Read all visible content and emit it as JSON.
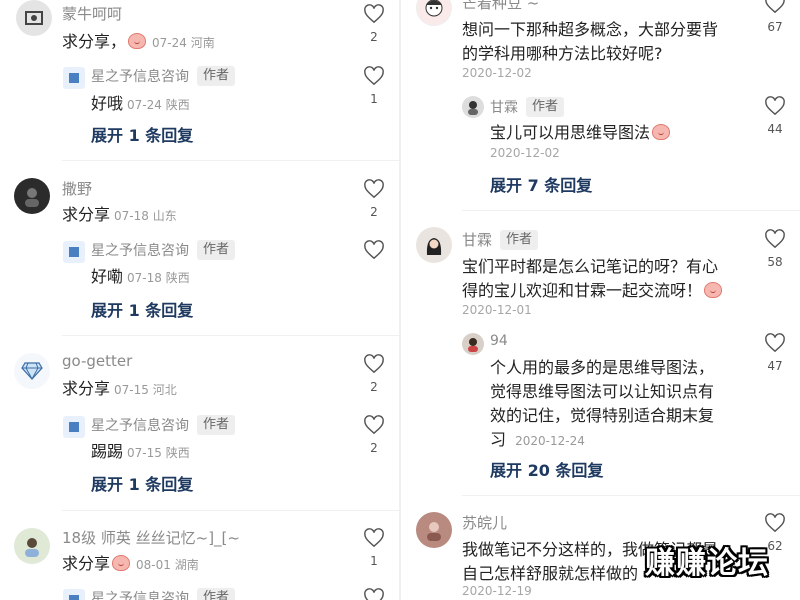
{
  "left": {
    "threads": [
      {
        "user": "蒙牛呵呵",
        "text": "求分享，",
        "emoji": true,
        "meta": "07-24 河南",
        "likes": "2",
        "reply": {
          "user": "星之予信息咨询",
          "tag": "作者",
          "text": "好哦",
          "meta": "07-24 陕西",
          "likes": "1"
        },
        "expand": "展开 1 条回复"
      },
      {
        "user": "撒野",
        "text": "求分享",
        "emoji": false,
        "meta": "07-18 山东",
        "likes": "2",
        "reply": {
          "user": "星之予信息咨询",
          "tag": "作者",
          "text": "好嘞",
          "meta": "07-18 陕西",
          "likes": ""
        },
        "expand": "展开 1 条回复"
      },
      {
        "user": "go-getter",
        "text": "求分享",
        "emoji": false,
        "meta": "07-15 河北",
        "likes": "2",
        "reply": {
          "user": "星之予信息咨询",
          "tag": "作者",
          "text": "踢踢",
          "meta": "07-15 陕西",
          "likes": "2"
        },
        "expand": "展开 1 条回复"
      },
      {
        "user": "18级 师英 丝丝记忆~]_[~",
        "text": "求分享",
        "emoji": true,
        "meta": "08-01 湖南",
        "likes": "1",
        "reply": {
          "user": "星之予信息咨询",
          "tag": "作者"
        }
      }
    ]
  },
  "right": {
    "t1": {
      "user": "芒着种豆 ~",
      "likes": "67",
      "text_lines": [
        "想问一下那种超多概念，大部分要背",
        "的学科用哪种方法比较好呢?"
      ],
      "date": "2020-12-02",
      "reply": {
        "user": "甘霖",
        "tag": "作者",
        "text": "宝儿可以用思维导图法",
        "date": "2020-12-02",
        "likes": "44"
      },
      "expand": "展开 7 条回复"
    },
    "t2": {
      "user": "甘霖",
      "tag": "作者",
      "likes": "58",
      "text_lines": [
        "宝们平时都是怎么记笔记的呀？有心",
        "得的宝儿欢迎和甘霖一起交流呀！"
      ],
      "date": "2020-12-01",
      "reply": {
        "user": "94",
        "likes": "47",
        "text_lines": [
          "个人用的最多的是思维导图法，",
          "觉得思维导图法可以让知识点有",
          "效的记住，觉得特别适合期末复",
          "习"
        ],
        "date": "2020-12-24"
      },
      "expand": "展开 20 条回复"
    },
    "t3": {
      "user": "苏皖儿",
      "likes": "62",
      "text_lines": [
        "我做笔记不分这样的，我做笔记都是",
        "自己怎样舒服就怎样做的"
      ],
      "date": "2020-12-19"
    }
  },
  "watermark": "赚赚论坛",
  "colors": {
    "expand": "#1f3a60",
    "name": "#8a8a8a",
    "date": "#a6a6a6"
  }
}
